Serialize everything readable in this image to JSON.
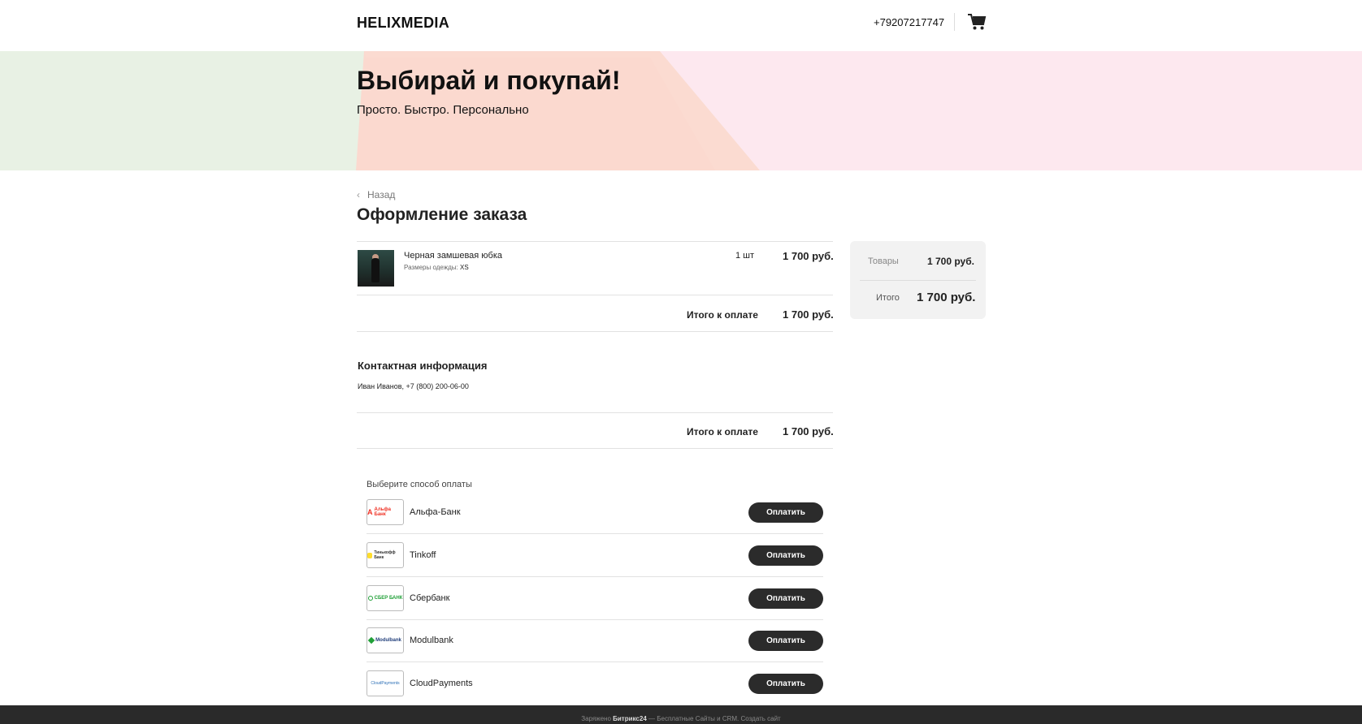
{
  "header": {
    "logo": "HELIXMEDIA",
    "phone": "+79207217747",
    "cart_icon": "cart-icon"
  },
  "hero": {
    "title": "Выбирай и покупай!",
    "subtitle": "Просто. Быстро. Персонально"
  },
  "back": {
    "label": "Назад",
    "icon": "chevron-left-icon"
  },
  "page_title": "Оформление заказа",
  "order": {
    "item": {
      "name": "Черная замшевая юбка",
      "prop_label": "Размеры одежды:",
      "prop_value": "XS",
      "qty": "1 шт",
      "price": "1 700 руб."
    },
    "total_label": "Итого к оплате",
    "total_value": "1 700 руб."
  },
  "contact": {
    "title": "Контактная информация",
    "info": "Иван Иванов, +7 (800) 200-06-00"
  },
  "payment": {
    "title": "Выберите способ оплаты",
    "button_label": "Оплатить",
    "methods": [
      {
        "name": "Альфа-Банк",
        "logo_text": "Альфа Банк",
        "color": "#ef3124"
      },
      {
        "name": "Tinkoff",
        "logo_text": "Тинькофф Банк",
        "color": "#333333"
      },
      {
        "name": "Сбербанк",
        "logo_text": "СБЕР БАНК",
        "color": "#21a038"
      },
      {
        "name": "Modulbank",
        "logo_text": "Modulbank",
        "color": "#1f3d7a"
      },
      {
        "name": "CloudPayments",
        "logo_text": "CloudPayments",
        "color": "#2c6fb6"
      }
    ]
  },
  "summary": {
    "goods_label": "Товары",
    "goods_value": "1 700 руб.",
    "total_label": "Итого",
    "total_value": "1 700 руб."
  },
  "footer": {
    "prefix": "Заряжено",
    "brand": "Битрикс24",
    "suffix": "— Бесплатные Сайты и CRM.",
    "link": "Создать сайт"
  }
}
